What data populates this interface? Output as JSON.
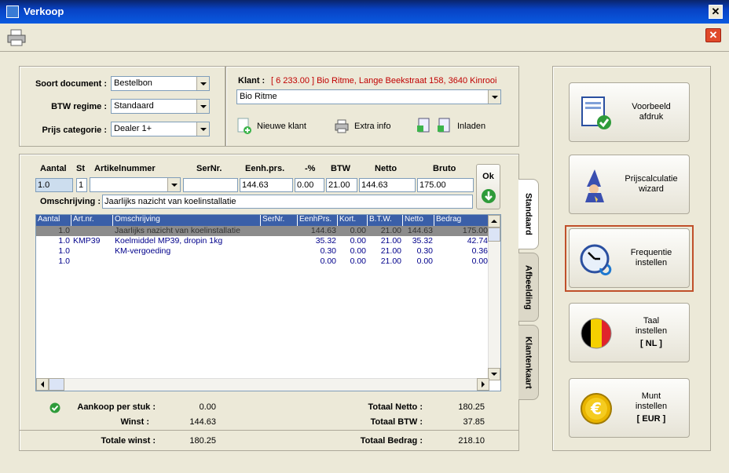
{
  "window": {
    "title": "Verkoop"
  },
  "header": {
    "soort_label": "Soort document :",
    "soort_value": "Bestelbon",
    "btw_label": "BTW regime :",
    "btw_value": "Standaard",
    "prijs_label": "Prijs categorie :",
    "prijs_value": "Dealer 1+",
    "klant_label": "Klant :",
    "klant_info": "[ 6 233.00 ] Bio Ritme, Lange Beekstraat 158, 3640 Kinrooi",
    "klant_value": "Bio Ritme",
    "nieuwe_klant": "Nieuwe klant",
    "extra_info": "Extra info",
    "inladen": "Inladen"
  },
  "entry": {
    "headers": {
      "aantal": "Aantal",
      "st": "St",
      "artikelnummer": "Artikelnummer",
      "sernr": "SerNr.",
      "eenhprs": "Eenh.prs.",
      "korting": "-%",
      "btw": "BTW",
      "netto": "Netto",
      "bruto": "Bruto"
    },
    "values": {
      "aantal": "1.0",
      "st": "1",
      "artikelnummer": "",
      "sernr": "",
      "eenhprs": "144.63",
      "korting": "0.00",
      "btw": "21.00",
      "netto": "144.63",
      "bruto": "175.00"
    },
    "omschrijving_label": "Omschrijving :",
    "omschrijving_value": "Jaarlijks nazicht van koelinstallatie",
    "ok_label": "Ok"
  },
  "grid": {
    "columns": [
      "Aantal",
      "Art.nr.",
      "Omschrijving",
      "SerNr.",
      "EenhPrs.",
      "Kort.",
      "B.T.W.",
      "Netto",
      "Bedrag"
    ],
    "rows": [
      [
        "1.0",
        "",
        "Jaarlijks nazicht van koelinstallatie",
        "",
        "144.63",
        "0.00",
        "21.00",
        "144.63",
        "175.00"
      ],
      [
        "1.0",
        "KMP39",
        "Koelmiddel MP39, dropin 1kg",
        "",
        "35.32",
        "0.00",
        "21.00",
        "35.32",
        "42.74"
      ],
      [
        "1.0",
        "",
        "KM-vergoeding",
        "",
        "0.30",
        "0.00",
        "21.00",
        "0.30",
        "0.36"
      ],
      [
        "1.0",
        "",
        "",
        "",
        "0.00",
        "0.00",
        "21.00",
        "0.00",
        "0.00"
      ]
    ]
  },
  "tabs": [
    "Standaard",
    "Afbeelding",
    "Klantenkaart"
  ],
  "summary": {
    "aankoop_label": "Aankoop per stuk :",
    "aankoop_value": "0.00",
    "winst_label": "Winst :",
    "winst_value": "144.63",
    "totale_winst_label": "Totale winst :",
    "totale_winst_value": "180.25",
    "totaal_netto_label": "Totaal Netto :",
    "totaal_netto_value": "180.25",
    "totaal_btw_label": "Totaal BTW :",
    "totaal_btw_value": "37.85",
    "totaal_bedrag_label": "Totaal Bedrag :",
    "totaal_bedrag_value": "218.10"
  },
  "actions": {
    "voorbeeld": [
      "Voorbeeld",
      "afdruk"
    ],
    "prijscalc": [
      "Prijscalculatie",
      "wizard"
    ],
    "frequentie": [
      "Frequentie",
      "instellen"
    ],
    "taal": [
      "Taal",
      "instellen"
    ],
    "taal_code": "[ NL ]",
    "munt": [
      "Munt",
      "instellen"
    ],
    "munt_code": "[ EUR ]"
  },
  "colors": {
    "accent_red": "#c00000",
    "grid_header": "#3a5fa8",
    "selected_row": "#8c8c8c",
    "focus_border": "#c0502a"
  }
}
